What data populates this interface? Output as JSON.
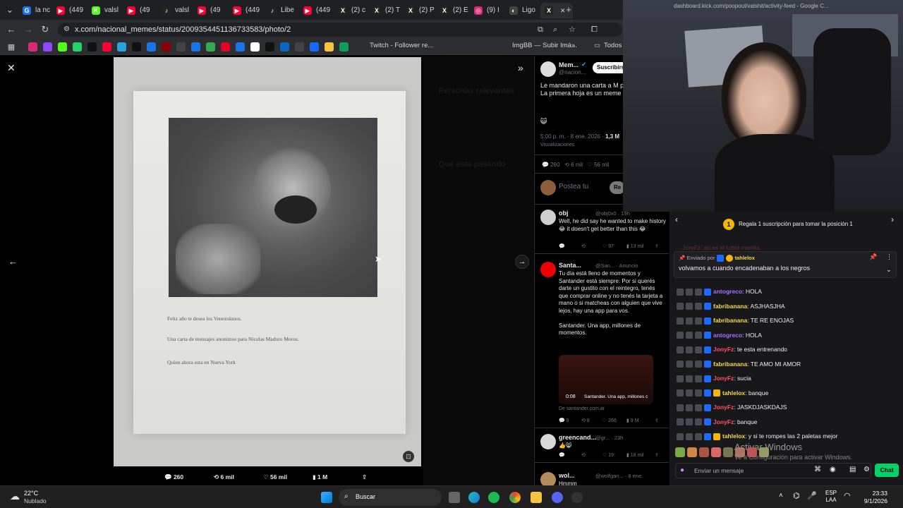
{
  "tabs": [
    {
      "label": "la nc",
      "color": "#1a73e8",
      "fav": "G"
    },
    {
      "label": "(449",
      "color": "#ff0033",
      "fav": "▶"
    },
    {
      "label": "valsl",
      "color": "#53fc18",
      "fav": "K"
    },
    {
      "label": "(49",
      "color": "#ff0033",
      "fav": "▶"
    },
    {
      "label": "valsl",
      "color": "#222222",
      "fav": "♪"
    },
    {
      "label": "(49",
      "color": "#ff0033",
      "fav": "▶"
    },
    {
      "label": "(449",
      "color": "#ff0033",
      "fav": "▶"
    },
    {
      "label": "Libe",
      "color": "#222222",
      "fav": "♪"
    },
    {
      "label": "(449",
      "color": "#ff0033",
      "fav": "▶"
    },
    {
      "label": "(2) c",
      "color": "#222222",
      "fav": "X"
    },
    {
      "label": "(2) T",
      "color": "#222222",
      "fav": "X"
    },
    {
      "label": "(2) P",
      "color": "#222222",
      "fav": "X"
    },
    {
      "label": "(2) E",
      "color": "#222222",
      "fav": "X"
    },
    {
      "label": "(9) I",
      "color": "#d62976",
      "fav": "◎"
    },
    {
      "label": "Ligo",
      "color": "#444444",
      "fav": "◐"
    },
    {
      "label": "",
      "color": "#222222",
      "fav": "X"
    }
  ],
  "address": {
    "url": "x.com/nacional_memes/status/2009354451136733583/photo/2"
  },
  "bookmarks": {
    "twitch": "Twitch - Follower re...",
    "imgbb": "ImgBB — Subir Imá...",
    "todos": "Todos l"
  },
  "photo": {
    "doc_line1": "Feliz año te desea los Venezolanos.",
    "doc_line2": "Una carta de mensajes anonimos para Nicolas Maduro Moros.",
    "doc_line3": "Quien ahora esta en Nueva York",
    "stats": {
      "replies": "260",
      "reposts": "6 mil",
      "likes": "56 mil",
      "views": "1 M"
    }
  },
  "post": {
    "author": "Mem...",
    "handle": "@nacion...",
    "subscribe": "Suscribirs",
    "text": "Le mandaron una carta a M prision.\nLa primera hoja es un meme de él, jajajajaja",
    "emoji": "😺",
    "time": "5:00 p. m. · 8 ene. 2026 ·",
    "views": "1,3 M",
    "views_label": "Visualizaciones",
    "replies": "260",
    "reposts": "6 mil",
    "likes": "56 mil",
    "reply_placeholder": "Postea tu",
    "reply_button": "Re"
  },
  "replies": [
    {
      "name": "obj",
      "handle": "@obj0x0 · 19h",
      "text": "Well, he did say he wanted to make history 😂 it doesn't get better than this 😂",
      "r": "",
      "rt": "",
      "l": "97",
      "v": "13 mil"
    },
    {
      "name": "Santa...",
      "handle": "@San... · Anuncio",
      "text": "Tu día está lleno de momentos y Santander está siempre. Por si querés darte un gustito con el reintegro, tenés que comprar online y no tenés la tarjeta a mano o si matcheas con alguien que vive lejos, hay una app para vos.\n\nSantander. Una app, millones de momentos.",
      "video_time": "0:08",
      "video_caption": "Santander. Una app, millones c",
      "source": "De santander.com.ar",
      "r": "9",
      "rt": "8",
      "l": "266",
      "v": "9 M"
    },
    {
      "name": "greencand...",
      "handle": "@gr... · 23h",
      "text": "👍😸",
      "r": "",
      "rt": "",
      "l": "19",
      "v": "18 mil"
    },
    {
      "name": "wol...",
      "handle": "@wolfgan... · 8 ene.",
      "text": "Hmmm",
      "r": "",
      "rt": "",
      "l": "",
      "v": ""
    }
  ],
  "chat": {
    "gift_banner": "Regala 1 suscripción para tomar la posición 1",
    "pinned_by_label": "Enviado por",
    "pinned_by": "tahlelox",
    "pinned_text": "volvamos a cuando encadenaban a los negros",
    "hidden_row": "JonyFz: asi es el futbol mamita",
    "messages": [
      {
        "user": "antogreco",
        "color": "#a970ff",
        "text": "HOLA"
      },
      {
        "user": "fabribanana",
        "color": "#f8d74a",
        "text": "ASJHASJHA"
      },
      {
        "user": "fabribanana",
        "color": "#f8d74a",
        "text": "TE RE ENOJAS"
      },
      {
        "user": "antogreco",
        "color": "#a970ff",
        "text": "HOLA"
      },
      {
        "user": "JonyFz",
        "color": "#ff4f6a",
        "text": "te esta entrenando"
      },
      {
        "user": "fabribanana",
        "color": "#f8d74a",
        "text": "TE AMO MI AMOR"
      },
      {
        "user": "JonyFz",
        "color": "#ff4f6a",
        "text": "sucia"
      },
      {
        "user": "tahlelox",
        "color": "#f8d74a",
        "text": "banque"
      },
      {
        "user": "JonyFz",
        "color": "#ff4f6a",
        "text": "JASKDJASKDAJS"
      },
      {
        "user": "JonyFz",
        "color": "#ff4f6a",
        "text": "banque"
      },
      {
        "user": "tahlelox",
        "color": "#f8d74a",
        "text": "y si te rompes las 2 paletas mejor"
      }
    ],
    "input_placeholder": "Enviar un mensaje",
    "chat_button": "Chat",
    "watermark1": "Activar Windows",
    "watermark2": "Ve a Configuración para activar Windows."
  },
  "cam_url": "dashboard.kick.com/poopout/valshit/activity-feed - Google C...",
  "taskbar": {
    "temp": "22°C",
    "weather": "Nublado",
    "search": "Buscar",
    "lang1": "ESP",
    "lang2": "LAA",
    "time": "23:33",
    "date": "9/1/2026"
  }
}
